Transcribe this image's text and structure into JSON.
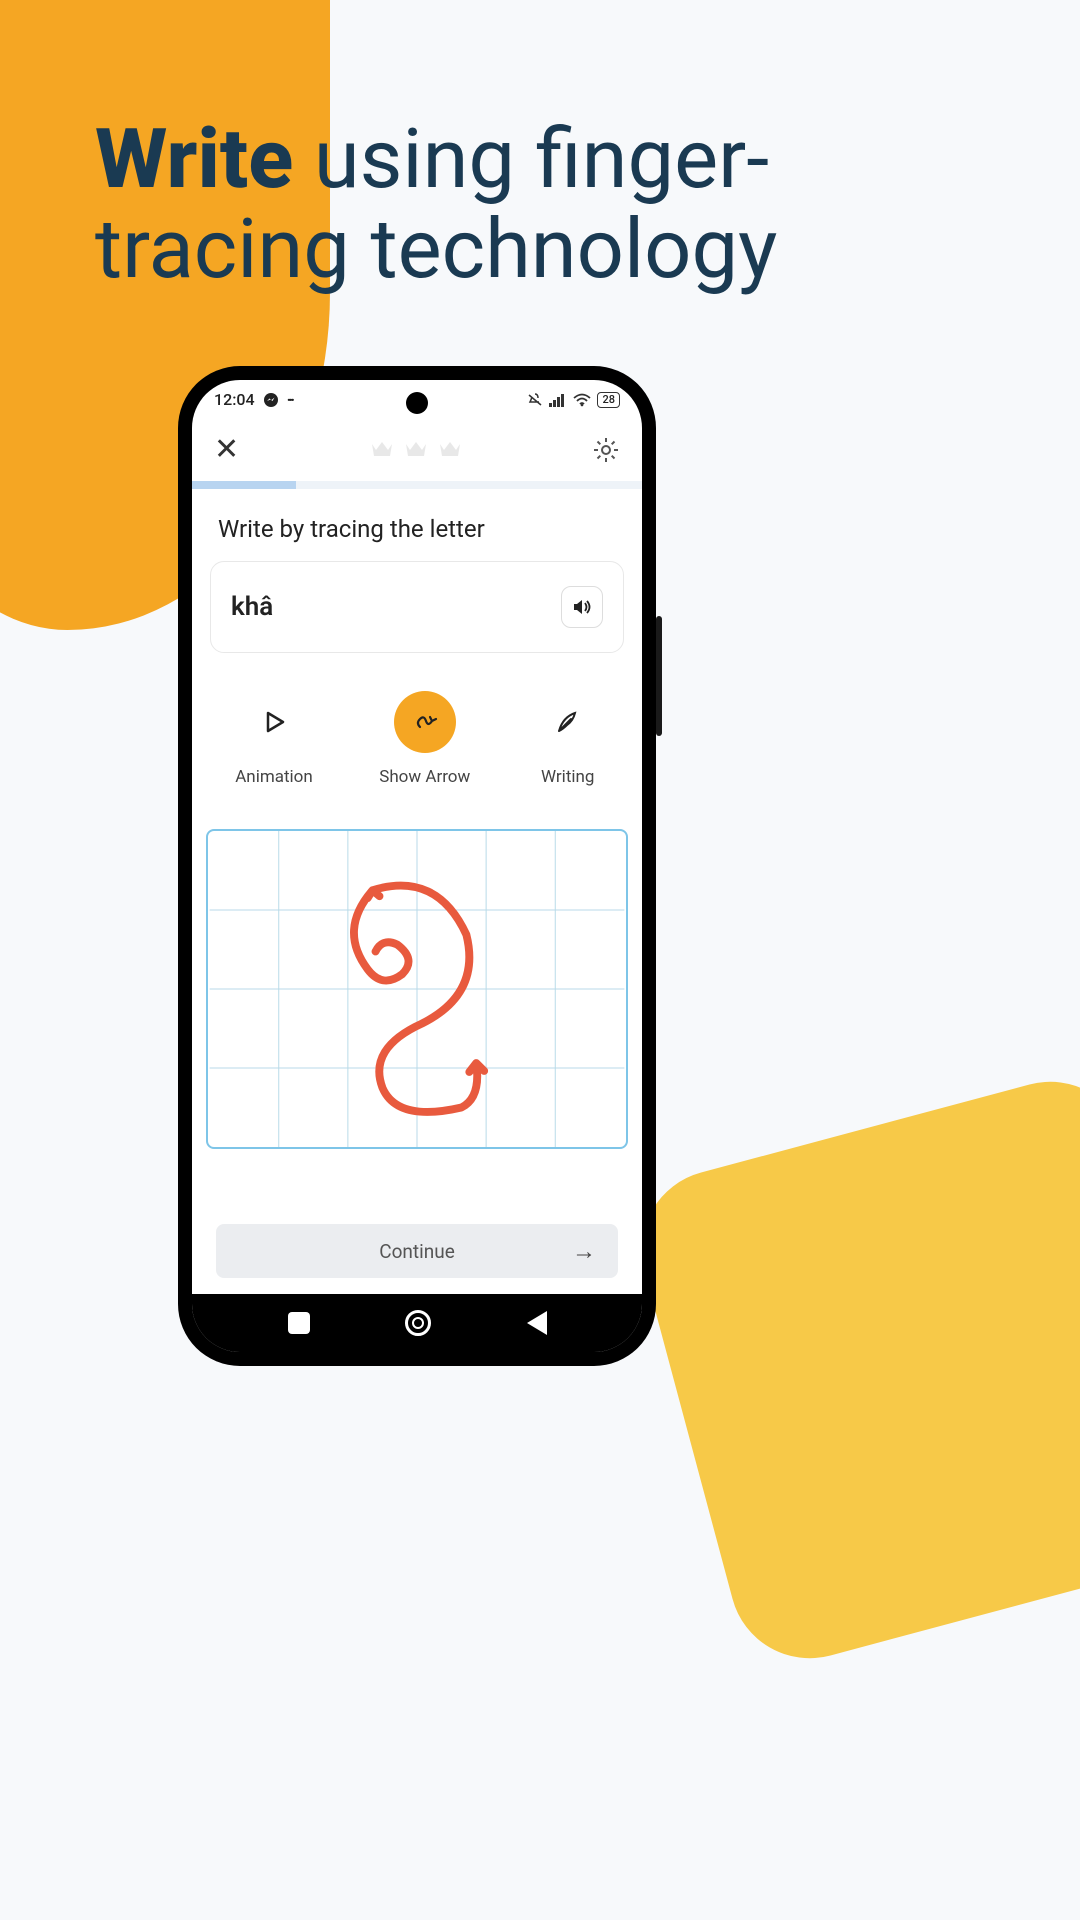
{
  "headline": {
    "bold": "Write",
    "rest": " using finger-tracing technology"
  },
  "status": {
    "time": "12:04",
    "battery": "28"
  },
  "instruction": "Write by tracing the letter",
  "word": "khâ",
  "modes": {
    "animation": "Animation",
    "show_arrow": "Show Arrow",
    "writing": "Writing"
  },
  "continue_label": "Continue",
  "colors": {
    "accent": "#f5a623",
    "navy": "#1a3a52",
    "stroke": "#e85a3e"
  }
}
